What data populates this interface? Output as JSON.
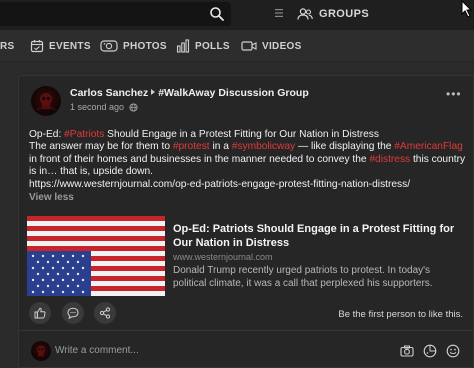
{
  "topbar": {
    "search_placeholder": "",
    "groups_label": "GROUPS"
  },
  "tabs": [
    {
      "label": "RS",
      "icon": "partial-icon"
    },
    {
      "label": "EVENTS",
      "icon": "calendar-icon"
    },
    {
      "label": "PHOTOS",
      "icon": "photos-icon"
    },
    {
      "label": "POLLS",
      "icon": "bar-chart-icon"
    },
    {
      "label": "VIDEOS",
      "icon": "video-icon"
    }
  ],
  "post": {
    "author": "Carlos Sanchez",
    "group": "#WalkAway Discussion Group",
    "time": "1 second ago",
    "privacy_icon": "globe-icon",
    "text": {
      "line1_a": "Op-Ed: ",
      "line1_tag": "#Patriots",
      "line1_b": " Should Engage in a Protest Fitting for Our Nation in Distress",
      "line2_a": "The answer may be for them to ",
      "line2_tag1": "#protest",
      "line2_b": " in a ",
      "line2_tag2": "#symbolicway",
      "line2_c": " — like displaying the ",
      "line2_tag3": "#AmericanFlag",
      "line2_d": " in front of their homes and businesses in the manner needed to convey the ",
      "line2_tag4": "#distress",
      "line2_e": " this country is in… that is, upside down.",
      "url": "https://www.westernjournal.com/op-ed-patriots-engage-protest-fitting-nation-distress/"
    },
    "view_less": "View less",
    "preview": {
      "title": "Op-Ed: Patriots Should Engage in a Protest Fitting for Our Nation in Distress",
      "domain": "www.westernjournal.com",
      "description": "Donald Trump recently urged patriots to protest. In today's political climate, it was a call that perplexed his supporters."
    },
    "first_like": "Be the first person to like this.",
    "comment_placeholder": "Write a comment..."
  },
  "colors": {
    "hashtag": "#e03a3a",
    "background": "#2a2a2a",
    "card": "#262626"
  }
}
